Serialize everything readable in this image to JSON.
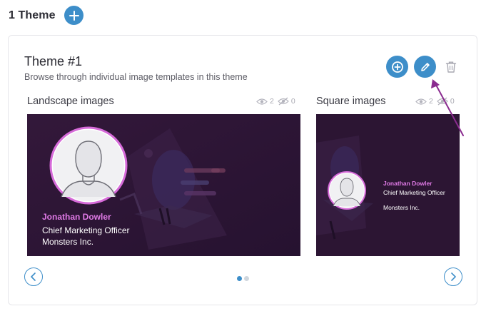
{
  "header": {
    "title": "1 Theme",
    "add_icon": "plus-icon"
  },
  "theme": {
    "title": "Theme #1",
    "description": "Browse through individual image templates in this theme",
    "actions": {
      "add_template_icon": "plus-circle-icon",
      "edit_icon": "pencil-icon",
      "delete_icon": "trash-icon"
    },
    "sections": [
      {
        "label": "Landscape images",
        "views": "2",
        "hidden": "0",
        "preview": {
          "name": "Jonathan Dowler",
          "job_title": "Chief Marketing Officer",
          "company": "Monsters Inc."
        }
      },
      {
        "label": "Square images",
        "views": "2",
        "hidden": "0",
        "preview": {
          "name": "Jonathan Dowler",
          "job_title": "Chief Marketing Officer",
          "company": "Monsters Inc."
        }
      }
    ],
    "pagination": {
      "pages": 2,
      "current": 1
    }
  },
  "colors": {
    "accent": "#3d8ec9",
    "card_bg": "#2f1636",
    "name_highlight": "#e07ae6",
    "annotation_arrow": "#8a2b8f"
  }
}
